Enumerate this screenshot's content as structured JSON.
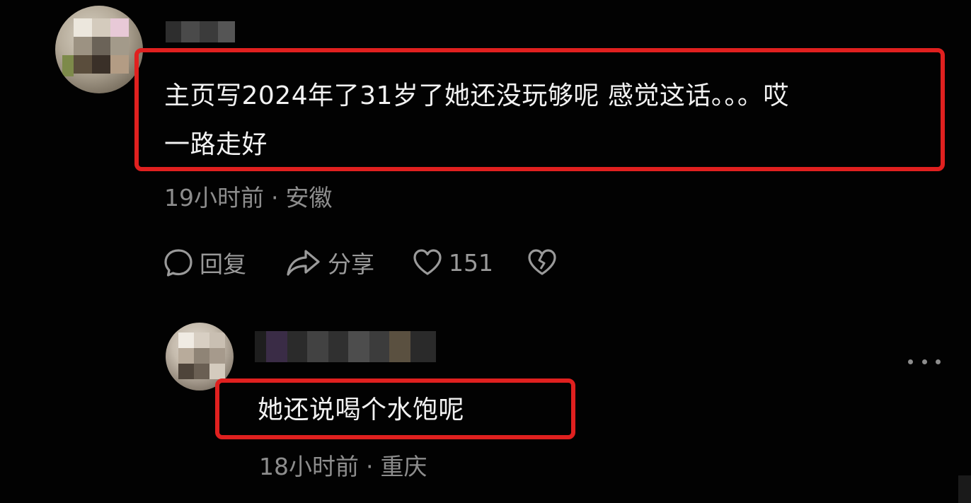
{
  "comment": {
    "text_line1": "主页写2024年了31岁了她还没玩够呢 感觉这话。。。哎",
    "text_line2": "一路走好",
    "time": "19小时前",
    "separator": "·",
    "location": "安徽",
    "actions": {
      "reply_label": "回复",
      "share_label": "分享",
      "like_count": "151"
    },
    "avatar_icon": "avatar-blurred",
    "username_icon": "username-pixelated"
  },
  "reply": {
    "text": "她还说喝个水饱呢",
    "time": "18小时前",
    "separator": "·",
    "location": "重庆",
    "more_icon": "more-dots-icon",
    "avatar_icon": "avatar-blurred",
    "username_icon": "username-pixelated"
  },
  "colors": {
    "background": "#020202",
    "highlight": "#e0201f",
    "text": "#f2f2f2",
    "meta": "#8d8d8d"
  }
}
